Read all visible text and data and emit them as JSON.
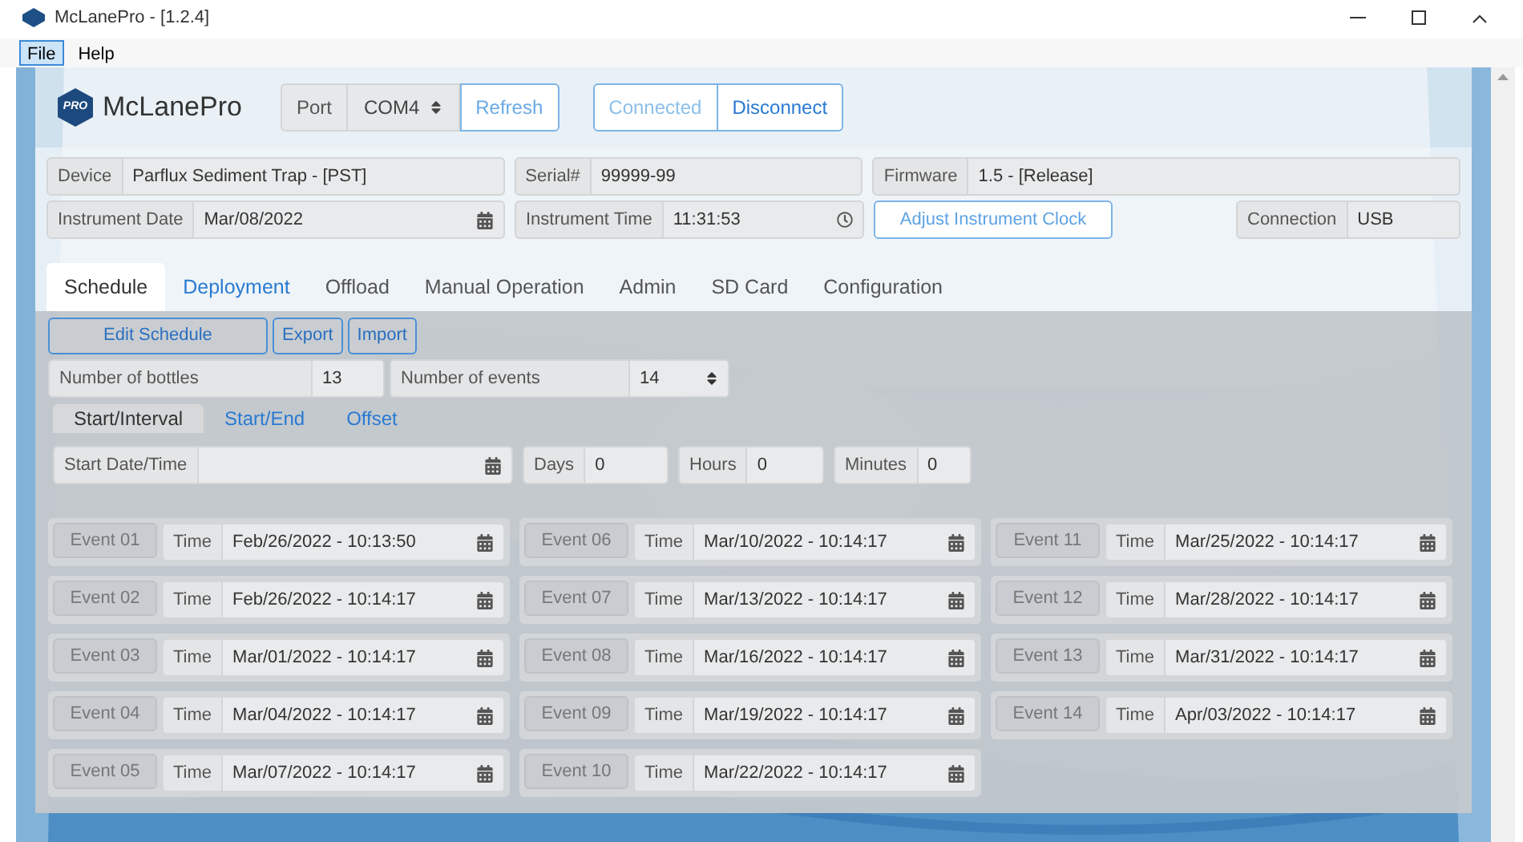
{
  "window": {
    "title": "McLanePro - [1.2.4]"
  },
  "menu": [
    {
      "label": "File",
      "selected": true
    },
    {
      "label": "Help",
      "selected": false
    }
  ],
  "header": {
    "logo_badge": "PRO",
    "app_name": "McLanePro",
    "port_label": "Port",
    "port_value": "COM4",
    "refresh": "Refresh",
    "connection_buttons": [
      {
        "label": "Connected",
        "disabled": true
      },
      {
        "label": "Disconnect",
        "disabled": false
      }
    ]
  },
  "info_row_1": [
    {
      "label": "Device",
      "value": "Parflux Sediment Trap - [PST]"
    },
    {
      "label": "Serial#",
      "value": "99999-99"
    },
    {
      "label": "Firmware",
      "value": "1.5 - [Release]"
    }
  ],
  "instrument_date": {
    "label": "Instrument Date",
    "value": "Mar/08/2022"
  },
  "instrument_time": {
    "label": "Instrument Time",
    "value": "11:31:53"
  },
  "adjust_clock": "Adjust Instrument Clock",
  "connection": {
    "label": "Connection",
    "value": "USB"
  },
  "tabs": [
    {
      "label": "Schedule",
      "selected": true,
      "hovered": false
    },
    {
      "label": "Deployment",
      "selected": false,
      "hovered": true
    },
    {
      "label": "Offload",
      "selected": false,
      "hovered": false
    },
    {
      "label": "Manual Operation",
      "selected": false,
      "hovered": false
    },
    {
      "label": "Admin",
      "selected": false,
      "hovered": false
    },
    {
      "label": "SD Card",
      "selected": false,
      "hovered": false
    },
    {
      "label": "Configuration",
      "selected": false,
      "hovered": false
    }
  ],
  "toolbar": [
    "Edit Schedule",
    "Export",
    "Import"
  ],
  "bottles": {
    "label": "Number of bottles",
    "value": "13"
  },
  "events_count": {
    "label": "Number of events",
    "value": "14"
  },
  "sub_tabs": [
    {
      "label": "Start/Interval",
      "selected": true
    },
    {
      "label": "Start/End",
      "selected": false
    },
    {
      "label": "Offset",
      "selected": false
    }
  ],
  "start_datetime": {
    "label": "Start Date/Time"
  },
  "intervals": [
    {
      "label": "Days",
      "value": "0"
    },
    {
      "label": "Hours",
      "value": "0"
    },
    {
      "label": "Minutes",
      "value": "0"
    }
  ],
  "events": [
    {
      "label": "Event 01",
      "time_label": "Time",
      "value": "Feb/26/2022 - 10:13:50"
    },
    {
      "label": "Event 02",
      "time_label": "Time",
      "value": "Feb/26/2022 - 10:14:17"
    },
    {
      "label": "Event 03",
      "time_label": "Time",
      "value": "Mar/01/2022 - 10:14:17"
    },
    {
      "label": "Event 04",
      "time_label": "Time",
      "value": "Mar/04/2022 - 10:14:17"
    },
    {
      "label": "Event 05",
      "time_label": "Time",
      "value": "Mar/07/2022 - 10:14:17"
    },
    {
      "label": "Event 06",
      "time_label": "Time",
      "value": "Mar/10/2022 - 10:14:17"
    },
    {
      "label": "Event 07",
      "time_label": "Time",
      "value": "Mar/13/2022 - 10:14:17"
    },
    {
      "label": "Event 08",
      "time_label": "Time",
      "value": "Mar/16/2022 - 10:14:17"
    },
    {
      "label": "Event 09",
      "time_label": "Time",
      "value": "Mar/19/2022 - 10:14:17"
    },
    {
      "label": "Event 10",
      "time_label": "Time",
      "value": "Mar/22/2022 - 10:14:17"
    },
    {
      "label": "Event 11",
      "time_label": "Time",
      "value": "Mar/25/2022 - 10:14:17"
    },
    {
      "label": "Event 12",
      "time_label": "Time",
      "value": "Mar/28/2022 - 10:14:17"
    },
    {
      "label": "Event 13",
      "time_label": "Time",
      "value": "Mar/31/2022 - 10:14:17"
    },
    {
      "label": "Event 14",
      "time_label": "Time",
      "value": "Apr/03/2022 - 10:14:17"
    }
  ]
}
